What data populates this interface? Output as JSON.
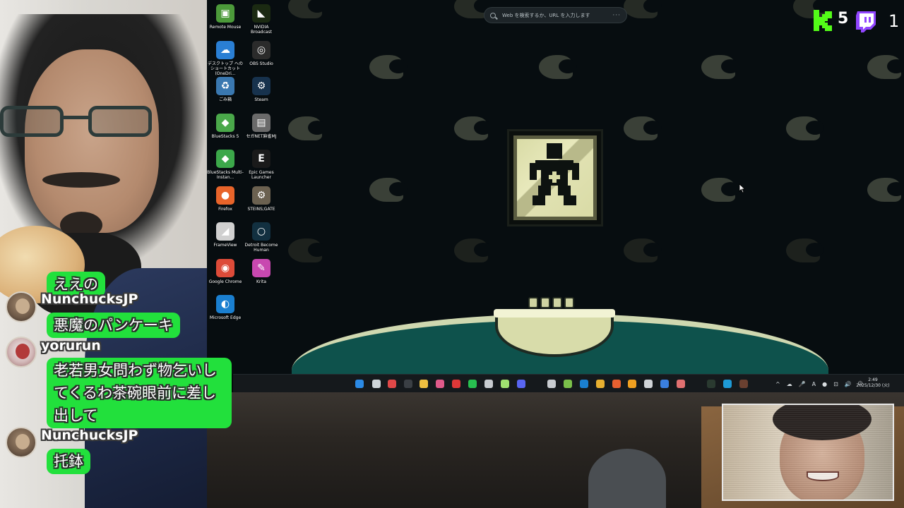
{
  "desktop": {
    "icons": [
      {
        "label": "Remote Mouse",
        "icon": "remote-mouse-icon",
        "color": "#4c9a3a",
        "glyph": "▣"
      },
      {
        "label": "NVIDIA Broadcast",
        "icon": "nvidia-broadcast-icon",
        "color": "#1b2a12",
        "glyph": "◣"
      },
      {
        "label": "デスクトップ へのショートカット (OneDri...",
        "icon": "onedrive-shortcut-icon",
        "color": "#2a7fd4",
        "glyph": "☁"
      },
      {
        "label": "OBS Studio",
        "icon": "obs-studio-icon",
        "color": "#2b2b2b",
        "glyph": "◎"
      },
      {
        "label": "ごみ箱",
        "icon": "recycle-bin-icon",
        "color": "#3a78b0",
        "glyph": "♻"
      },
      {
        "label": "Steam",
        "icon": "steam-icon",
        "color": "#17324d",
        "glyph": "⚙"
      },
      {
        "label": "BlueStacks 5",
        "icon": "bluestacks-icon",
        "color": "#4aa84a",
        "glyph": "◆"
      },
      {
        "label": "セガNET麻雀MJ",
        "icon": "sega-mj-icon",
        "color": "#6a6a6a",
        "glyph": "▤"
      },
      {
        "label": "BlueStacks Multi-Instan...",
        "icon": "bluestacks-multi-icon",
        "color": "#3ca84a",
        "glyph": "◆"
      },
      {
        "label": "Epic Games Launcher",
        "icon": "epic-games-icon",
        "color": "#1a1a1a",
        "glyph": "E"
      },
      {
        "label": "Firefox",
        "icon": "firefox-icon",
        "color": "#e8642a",
        "glyph": "●"
      },
      {
        "label": "STEINS;GATE",
        "icon": "steins-gate-icon",
        "color": "#6b6150",
        "glyph": "⚙"
      },
      {
        "label": "FrameView",
        "icon": "frameview-icon",
        "color": "#d0d0d0",
        "glyph": "◢"
      },
      {
        "label": "Detroit Become Human",
        "icon": "detroit-icon",
        "color": "#123040",
        "glyph": "○"
      },
      {
        "label": "Google Chrome",
        "icon": "chrome-icon",
        "color": "#dd4b39",
        "glyph": "◉"
      },
      {
        "label": "Krita",
        "icon": "krita-icon",
        "color": "#c848b0",
        "glyph": "✎"
      },
      {
        "label": "Microsoft Edge",
        "icon": "edge-icon",
        "color": "#1a7fd0",
        "glyph": "◐"
      }
    ],
    "search_placeholder": "Web を検索するか、URL を入力します",
    "search_more": "···"
  },
  "overlay": {
    "kick_count": "5",
    "twitch_count": "1",
    "kick_color": "#53fc18",
    "twitch_color": "#9146ff"
  },
  "chat": {
    "bubble_color": "#22e03c",
    "messages": [
      {
        "user": "",
        "text": "ええの"
      },
      {
        "user": "NunchucksJP",
        "text": "悪魔のパンケーキ"
      },
      {
        "user": "yorurun",
        "text": "老若男女問わず物乞いしてくるわ茶碗眼前に差し出して"
      },
      {
        "user": "NunchucksJP",
        "text": "托鉢"
      }
    ]
  },
  "taskbar": {
    "clock_time": "2:49",
    "clock_date": "2025/12/30 (火)",
    "tray": [
      "^",
      "☁",
      "🎤",
      "A",
      "●",
      "⊡",
      "🔊",
      "⏻"
    ]
  }
}
